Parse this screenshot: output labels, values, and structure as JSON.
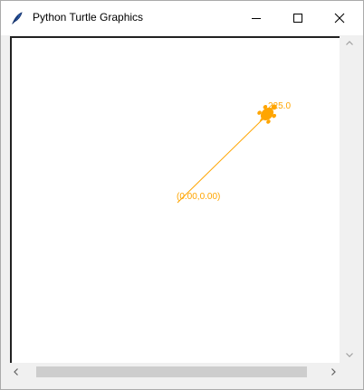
{
  "window": {
    "title": "Python Turtle Graphics",
    "controls": [
      "minimize",
      "maximize",
      "close"
    ]
  },
  "canvas": {
    "background": "#ffffff",
    "pen_color": "#FFA500",
    "origin_label": "(0.00,0.00)",
    "heading_label": "225.0"
  },
  "scrollbars": {
    "vertical": {
      "up_icon": "chevron-up-icon",
      "down_icon": "chevron-down-icon"
    },
    "horizontal": {
      "left_icon": "chevron-left-icon",
      "right_icon": "chevron-right-icon"
    }
  },
  "icons": {
    "app": "feather-icon",
    "turtle": "turtle-shape-icon"
  }
}
